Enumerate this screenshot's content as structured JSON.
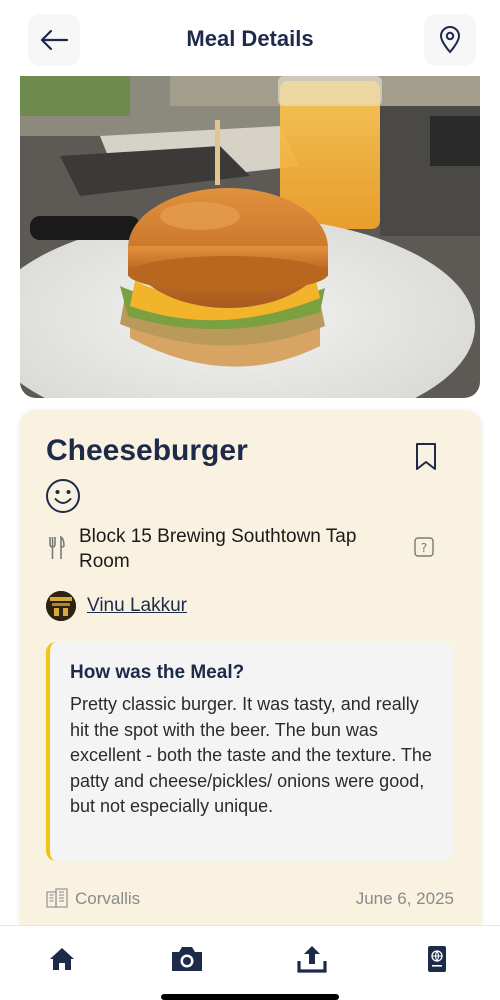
{
  "header": {
    "title": "Meal Details",
    "back_icon": "arrow-left-icon",
    "map_icon": "map-pin-icon"
  },
  "photo": {
    "subject": "cheeseburger-photo"
  },
  "meal": {
    "name": "Cheeseburger",
    "rating_icon": "smiley-face-icon",
    "bookmark_icon": "bookmark-icon",
    "restaurant": "Block 15 Brewing Southtown Tap Room",
    "restaurant_icon": "fork-knife-icon",
    "help_icon": "question-box-icon",
    "author": "Vinu Lakkur"
  },
  "review": {
    "title": "How was the Meal?",
    "text": "Pretty classic burger. It was tasty, and really hit the spot with the beer. The bun was excellent - both the taste and the texture. The patty and cheese/pickles/ onions were good, but not especially unique."
  },
  "footer": {
    "city": "Corvallis",
    "date": "June 6, 2025",
    "city_icon": "building-icon"
  },
  "tabs": [
    {
      "name": "home",
      "icon": "home-icon"
    },
    {
      "name": "camera",
      "icon": "camera-icon"
    },
    {
      "name": "upload",
      "icon": "upload-icon"
    },
    {
      "name": "passport",
      "icon": "passport-icon"
    }
  ],
  "colors": {
    "navy": "#1d2a4a",
    "card_bg": "#faf2e1",
    "accent_bar": "#f0c419",
    "muted": "#8a8a8a"
  }
}
